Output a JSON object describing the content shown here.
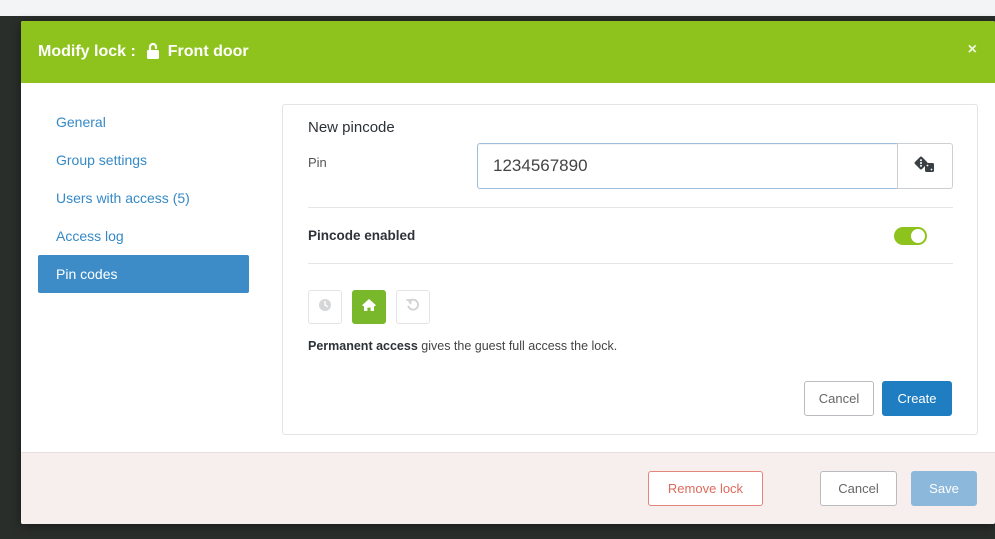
{
  "header": {
    "title_prefix": "Modify lock :",
    "lock_name": "Front door",
    "lock_icon": "unlocked-padlock-icon",
    "close_label": "×"
  },
  "sidebar": {
    "items": [
      {
        "label": "General",
        "active": false
      },
      {
        "label": "Group settings",
        "active": false
      },
      {
        "label": "Users with access (5)",
        "active": false
      },
      {
        "label": "Access log",
        "active": false
      },
      {
        "label": "Pin codes",
        "active": true
      }
    ]
  },
  "pincode_form": {
    "title": "New pincode",
    "pin_label": "Pin",
    "pin_value": "1234567890",
    "generate_icon": "dice-icon",
    "enabled_label": "Pincode enabled",
    "enabled": true,
    "modes": [
      {
        "icon": "clock-icon",
        "active": false
      },
      {
        "icon": "home-icon",
        "active": true
      },
      {
        "icon": "recurring-icon",
        "active": false
      }
    ],
    "description_bold": "Permanent access",
    "description_rest": " gives the guest full access the lock.",
    "cancel_label": "Cancel",
    "create_label": "Create"
  },
  "footer": {
    "remove_label": "Remove lock",
    "cancel_label": "Cancel",
    "save_label": "Save"
  },
  "colors": {
    "header_green": "#8ec31e",
    "sidebar_active": "#3d8cc7",
    "primary_blue": "#1f7ec2",
    "danger": "#de6a5d"
  }
}
